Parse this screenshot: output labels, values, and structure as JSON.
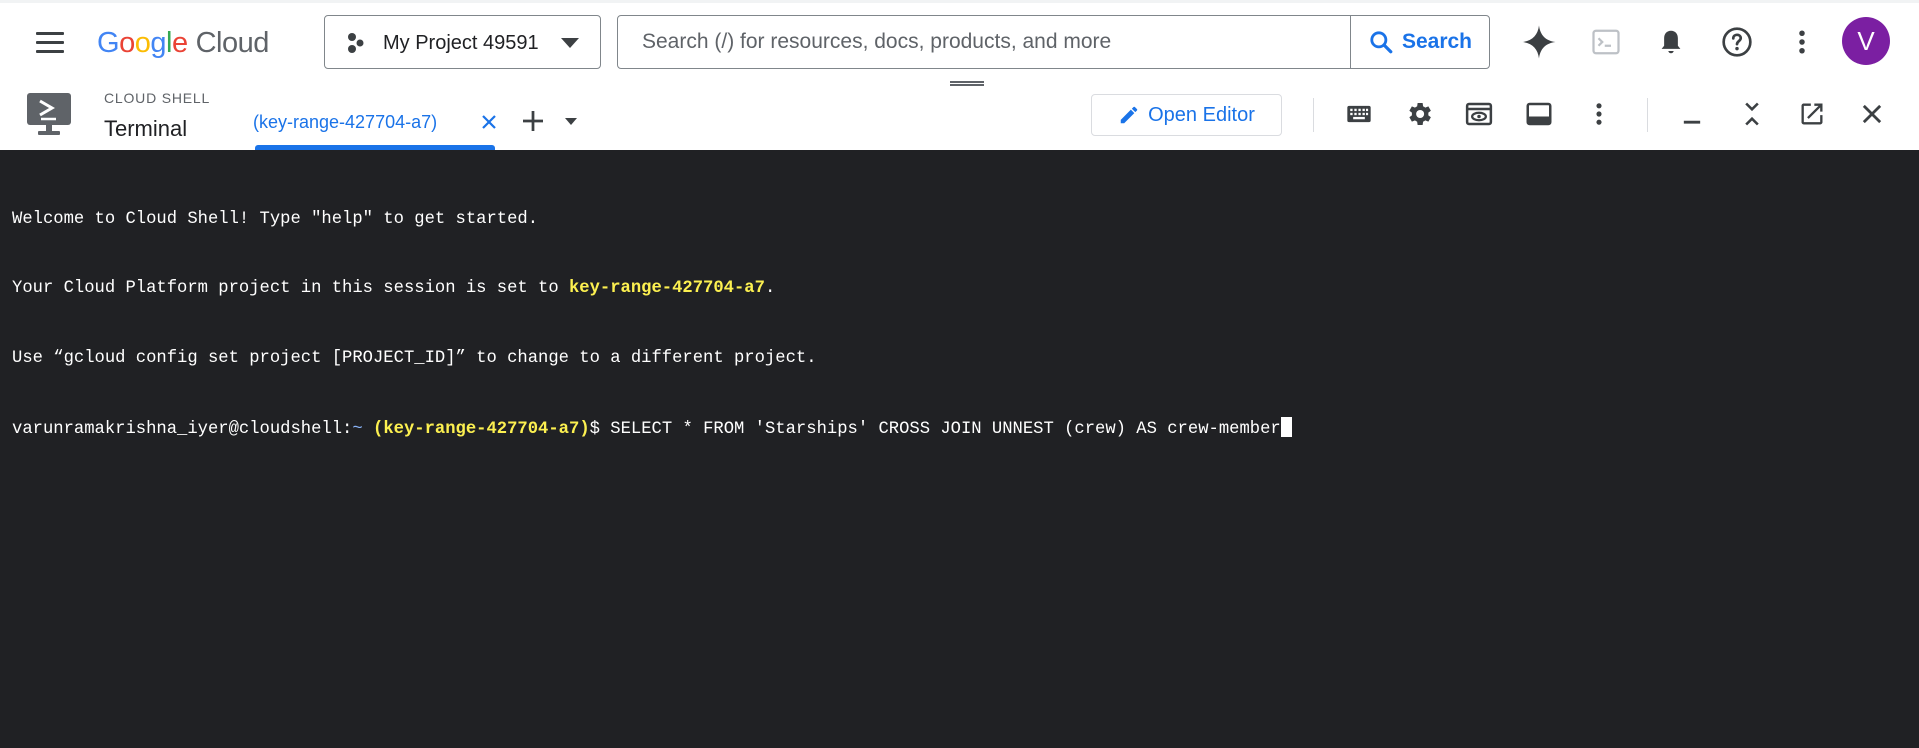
{
  "header": {
    "logo": {
      "google": "Google",
      "cloud": "Cloud"
    },
    "project": {
      "label": "My Project 49591"
    },
    "search": {
      "placeholder": "Search (/) for resources, docs, products, and more",
      "button_label": "Search"
    },
    "icons": [
      "menu-icon",
      "gemini-sparkle-icon",
      "cloud-shell-icon",
      "notifications-icon",
      "help-icon",
      "more-vert-icon"
    ],
    "avatar_initial": "V",
    "avatar_color": "#7b1fa2"
  },
  "shell": {
    "kicker": "CLOUD SHELL",
    "title": "Terminal",
    "tab": {
      "label": "(key-range-427704-a7)"
    },
    "open_editor_label": "Open Editor",
    "toolbar_icons": [
      "keyboard-icon",
      "settings-icon",
      "web-preview-icon",
      "panel-layout-icon",
      "more-vert-icon",
      "minimize-icon",
      "collapse-icon",
      "open-new-window-icon",
      "close-icon"
    ]
  },
  "terminal": {
    "line1": "Welcome to Cloud Shell! Type \"help\" to get started.",
    "line2_prefix": "Your Cloud Platform project in this session is set to ",
    "line2_project": "key-range-427704-a7",
    "line2_suffix": ".",
    "line3": "Use “gcloud config set project [PROJECT_ID]” to change to a different project.",
    "prompt_user": "varunramakrishna_iyer@cloudshell:",
    "prompt_tilde": "~",
    "prompt_project": "(key-range-427704-a7)",
    "prompt_symbol": "$ ",
    "command": "SELECT * FROM 'Starships' CROSS JOIN UNNEST (crew) AS crew-member"
  },
  "colors": {
    "accent": "#1a73e8",
    "terminal_bg": "#202124",
    "terminal_highlight": "#fcf050",
    "terminal_tilde": "#8ab4f8"
  }
}
